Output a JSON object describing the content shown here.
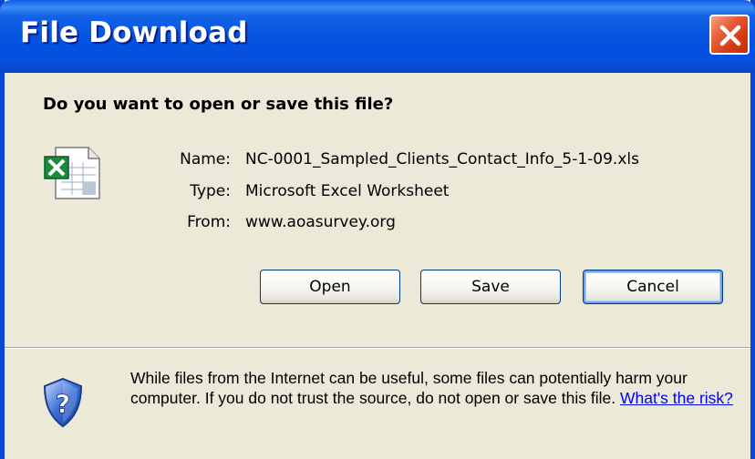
{
  "window": {
    "title": "File Download"
  },
  "prompt": {
    "heading": "Do you want to open or save this file?"
  },
  "file": {
    "name_label": "Name:",
    "name_value": "NC-0001_Sampled_Clients_Contact_Info_5-1-09.xls",
    "type_label": "Type:",
    "type_value": "Microsoft Excel Worksheet",
    "from_label": "From:",
    "from_value": "www.aoasurvey.org",
    "icon": "excel-file-icon"
  },
  "buttons": {
    "open": "Open",
    "save": "Save",
    "cancel": "Cancel"
  },
  "warning": {
    "text": "While files from the Internet can be useful, some files can potentially harm your computer. If you do not trust the source, do not open or save this file.",
    "link": "What's the risk?",
    "icon": "security-shield-icon"
  },
  "colors": {
    "titlebar": "#0352df",
    "dialog_bg": "#ece9d8",
    "close_button": "#d33a12",
    "link": "#0000ff"
  }
}
